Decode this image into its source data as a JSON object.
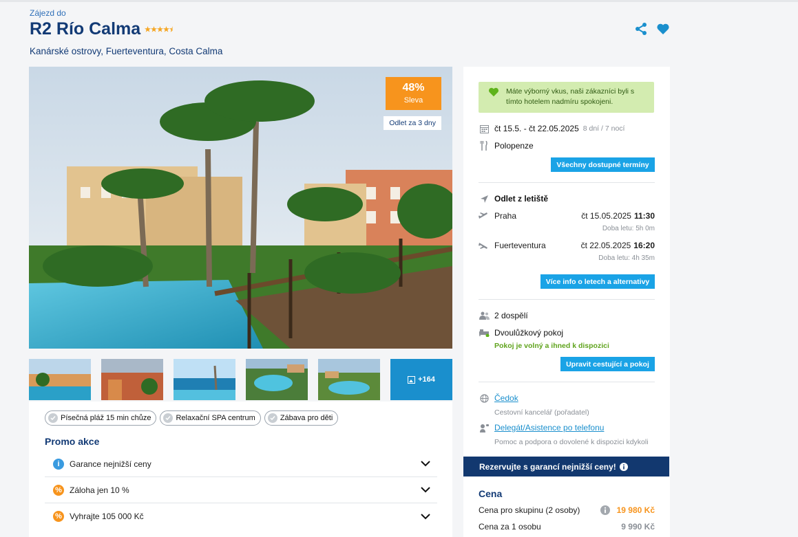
{
  "header": {
    "kicker": "Zájezd do",
    "hotel_name": "R2 Río Calma",
    "star_rating": 4.5,
    "location": "Kanárské ostrovy, Fuerteventura, Costa Calma"
  },
  "hero": {
    "discount_pct": "48%",
    "discount_label": "Sleva",
    "departure_tag": "Odlet za 3 dny"
  },
  "gallery": {
    "more_count": "+164"
  },
  "features": [
    "Písečná pláž 15 min chůze",
    "Relaxační SPA centrum",
    "Zábava pro děti"
  ],
  "promo": {
    "title": "Promo akce",
    "items": [
      {
        "label": "Garance nejnižší ceny",
        "icon": "info-icon",
        "color": "#3a9be0"
      },
      {
        "label": "Záloha jen 10 %",
        "icon": "percent-icon",
        "color": "#f7941d"
      },
      {
        "label": "Vyhrajte 105 000 Kč",
        "icon": "percent-icon",
        "color": "#f7941d"
      }
    ]
  },
  "sidebar": {
    "praise": "Máte výborný vkus, naši zákazníci byli s tímto hotelem nadmíru spokojeni.",
    "dates": "čt 15.5. - čt 22.05.2025",
    "duration": "8 dní / 7 nocí",
    "board": "Polopenze",
    "all_dates_button": "Všechny dostupné termíny",
    "departure_heading": "Odlet z letiště",
    "outbound": {
      "city": "Praha",
      "date": "čt 15.05.2025",
      "time": "11:30",
      "flight_time": "Doba letu: 5h 0m"
    },
    "inbound": {
      "city": "Fuerteventura",
      "date": "čt 22.05.2025",
      "time": "16:20",
      "flight_time": "Doba letu: 4h 35m"
    },
    "flights_button": "Více info o letech a alternativy",
    "travellers": "2 dospělí",
    "room": "Dvoulůžkový pokoj",
    "room_status": "Pokoj je volný a ihned k dispozici",
    "edit_button": "Upravit cestující a pokoj",
    "agency_link": "Čedok",
    "agency_desc": "Cestovní kancelář (pořadatel)",
    "support_link": "Delegát/Asistence po telefonu",
    "support_desc": "Pomoc a podpora o dovolené k dispozici kdykoli"
  },
  "guarantee_banner": "Rezervujte s garancí nejnižší ceny!",
  "price": {
    "title": "Cena",
    "group_label": "Cena pro skupinu (2 osoby)",
    "group_value": "19 980 Kč",
    "person_label": "Cena za 1 osobu",
    "person_value": "9 990 Kč"
  },
  "colors": {
    "navy": "#123a75",
    "accent_blue": "#1aa3e6",
    "orange": "#f7941d",
    "green_ok": "#5fa31c"
  }
}
